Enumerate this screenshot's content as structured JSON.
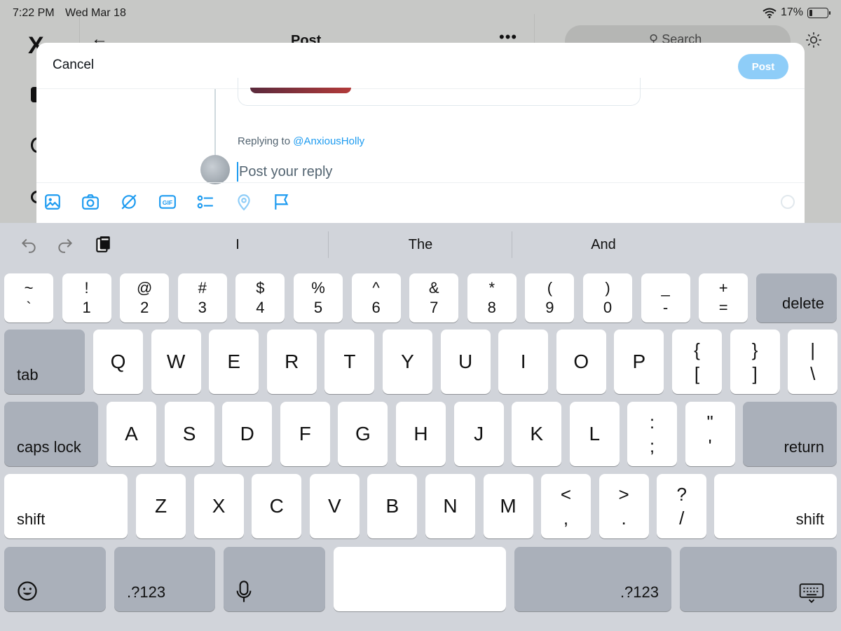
{
  "status": {
    "time": "7:22 PM",
    "date": "Wed Mar 18",
    "battery_text": "17%",
    "battery_level": 0.17
  },
  "background": {
    "logo": "X",
    "title": "Post",
    "more": "•••",
    "search_placeholder": "Search"
  },
  "compose": {
    "cancel_label": "Cancel",
    "post_label": "Post",
    "replying_prefix": "Replying to",
    "replying_handle": "@AnxiousHolly",
    "reply_placeholder": "Post your reply",
    "tools": [
      "image-icon",
      "camera-icon",
      "grok-icon",
      "gif-icon",
      "poll-icon",
      "location-icon",
      "flag-icon"
    ],
    "gif_text": "GIF",
    "accent": "#1d9bf0",
    "post_button_color": "#8ecdf8"
  },
  "keyboard": {
    "suggestions": [
      "I",
      "The",
      "And"
    ],
    "number_row": [
      {
        "top": "~",
        "bottom": "`"
      },
      {
        "top": "!",
        "bottom": "1"
      },
      {
        "top": "@",
        "bottom": "2"
      },
      {
        "top": "#",
        "bottom": "3"
      },
      {
        "top": "$",
        "bottom": "4"
      },
      {
        "top": "%",
        "bottom": "5"
      },
      {
        "top": "^",
        "bottom": "6"
      },
      {
        "top": "&",
        "bottom": "7"
      },
      {
        "top": "*",
        "bottom": "8"
      },
      {
        "top": "(",
        "bottom": "9"
      },
      {
        "top": ")",
        "bottom": "0"
      },
      {
        "top": "_",
        "bottom": "-"
      },
      {
        "top": "+",
        "bottom": "="
      }
    ],
    "delete_label": "delete",
    "tab_label": "tab",
    "row_q": [
      "Q",
      "W",
      "E",
      "R",
      "T",
      "Y",
      "U",
      "I",
      "O",
      "P"
    ],
    "row_q_symbols": [
      {
        "top": "{",
        "bottom": "["
      },
      {
        "top": "}",
        "bottom": "]"
      },
      {
        "top": "|",
        "bottom": "\\"
      }
    ],
    "caps_label": "caps lock",
    "row_a": [
      "A",
      "S",
      "D",
      "F",
      "G",
      "H",
      "J",
      "K",
      "L"
    ],
    "row_a_symbols": [
      {
        "top": ":",
        "bottom": ";"
      },
      {
        "top": "\"",
        "bottom": "'"
      }
    ],
    "return_label": "return",
    "shift_label": "shift",
    "row_z": [
      "Z",
      "X",
      "C",
      "V",
      "B",
      "N",
      "M"
    ],
    "row_z_symbols": [
      {
        "top": "<",
        "bottom": ","
      },
      {
        "top": ">",
        "bottom": "."
      },
      {
        "top": "?",
        "bottom": "/"
      }
    ],
    "numbers_label": ".?123",
    "bottom_icons": [
      "emoji-icon",
      "microphone-icon",
      "keyboard-dismiss-icon"
    ]
  }
}
